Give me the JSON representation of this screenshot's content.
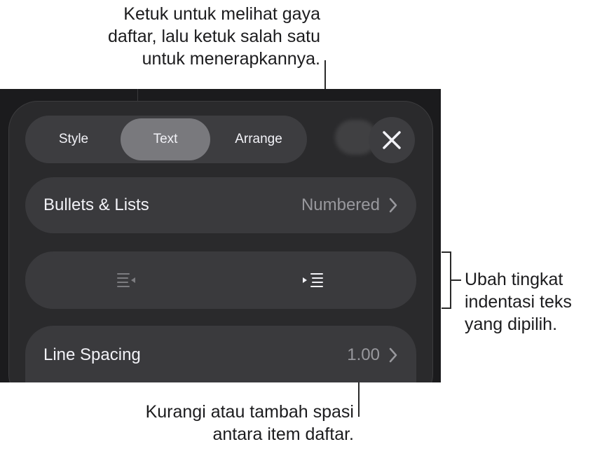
{
  "callouts": {
    "top": [
      "Ketuk untuk melihat gaya",
      "daftar, lalu ketuk salah satu",
      "untuk menerapkannya."
    ],
    "right": [
      "Ubah tingkat",
      "indentasi teks",
      "yang dipilih."
    ],
    "bottom": [
      "Kurangi atau tambah spasi",
      "antara item daftar."
    ]
  },
  "tabs": {
    "style": "Style",
    "text": "Text",
    "arrange": "Arrange",
    "selected": "Text"
  },
  "rows": {
    "bullets": {
      "label": "Bullets & Lists",
      "value": "Numbered"
    },
    "spacing": {
      "label": "Line Spacing",
      "value": "1.00"
    }
  },
  "icons": {
    "close": "close-icon",
    "chevron": "chevron-right-icon",
    "decrease_indent": "decrease-indent-icon",
    "increase_indent": "increase-indent-icon"
  },
  "colors": {
    "accent_tab": "#79797d",
    "panel": "#2a2a2c",
    "row": "#3a3a3d",
    "value_text": "#98989d"
  }
}
